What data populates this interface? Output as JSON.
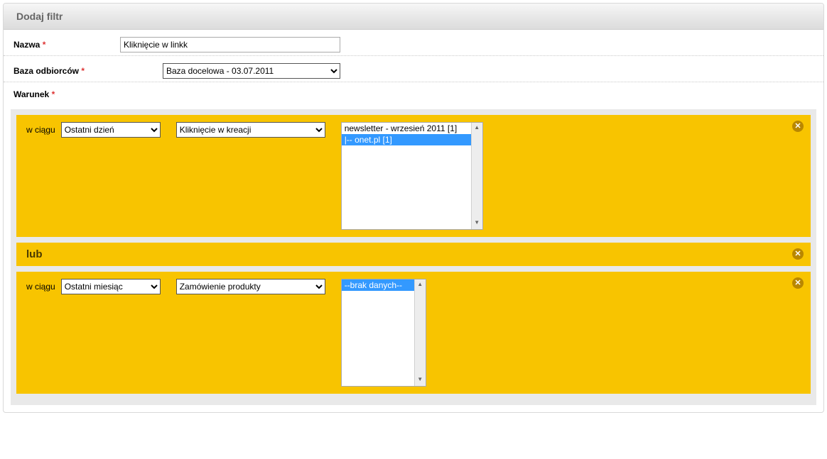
{
  "header": {
    "title": "Dodaj filtr"
  },
  "form": {
    "name": {
      "label": "Nazwa",
      "value": "Kliknięcie w linkk"
    },
    "base": {
      "label": "Baza odbiorców",
      "value": "Baza docelowa - 03.07.2011"
    },
    "condition_label": "Warunek"
  },
  "or_label": "lub",
  "w_ciagu_label": "w ciągu",
  "remove_glyph": "✕",
  "conditions": [
    {
      "time": "Ostatni dzień",
      "event": "Kliknięcie w kreacji",
      "list": {
        "width": "normal",
        "items": [
          {
            "text": "newsletter - wrzesień 2011 [1]",
            "selected": false
          },
          {
            "text": "|-- onet.pl [1]",
            "selected": true
          }
        ]
      }
    },
    {
      "time": "Ostatni miesiąc",
      "event": "Zamówienie produkty",
      "list": {
        "width": "narrow",
        "items": [
          {
            "text": "--brak danych--",
            "selected": true
          }
        ]
      }
    }
  ]
}
